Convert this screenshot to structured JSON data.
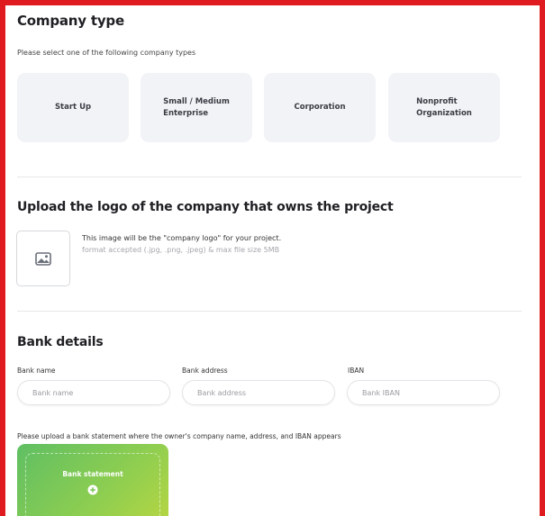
{
  "company_type": {
    "title": "Company type",
    "subtitle": "Please select one of the following company types",
    "options": [
      {
        "line1": "Start Up",
        "line2": ""
      },
      {
        "line1": "Small / Medium",
        "line2": "Enterprise"
      },
      {
        "line1": "Corporation",
        "line2": ""
      },
      {
        "line1": "Nonprofit",
        "line2": "Organization"
      }
    ]
  },
  "logo": {
    "title": "Upload the logo of the company that owns the project",
    "description": "This image will be the \"company logo\" for your project.",
    "format_hint": "format accepted (.jpg, .png, .jpeg) & max file size 5MB",
    "icon": "image-icon"
  },
  "bank": {
    "title": "Bank details",
    "fields": [
      {
        "label": "Bank name",
        "placeholder": "Bank name"
      },
      {
        "label": "Bank address",
        "placeholder": "Bank address"
      },
      {
        "label": "IBAN",
        "placeholder": "Bank IBAN"
      }
    ],
    "statement_hint": "Please upload a bank statement where the owner's company name, address, and IBAN appears",
    "statement_button": "Bank statement",
    "statement_icon": "plus-circle-icon"
  },
  "colors": {
    "frame_border": "#e01b1f",
    "card_bg": "#f2f3f6",
    "upload_gradient_start": "#5fbf63",
    "upload_gradient_end": "#b6d642"
  }
}
